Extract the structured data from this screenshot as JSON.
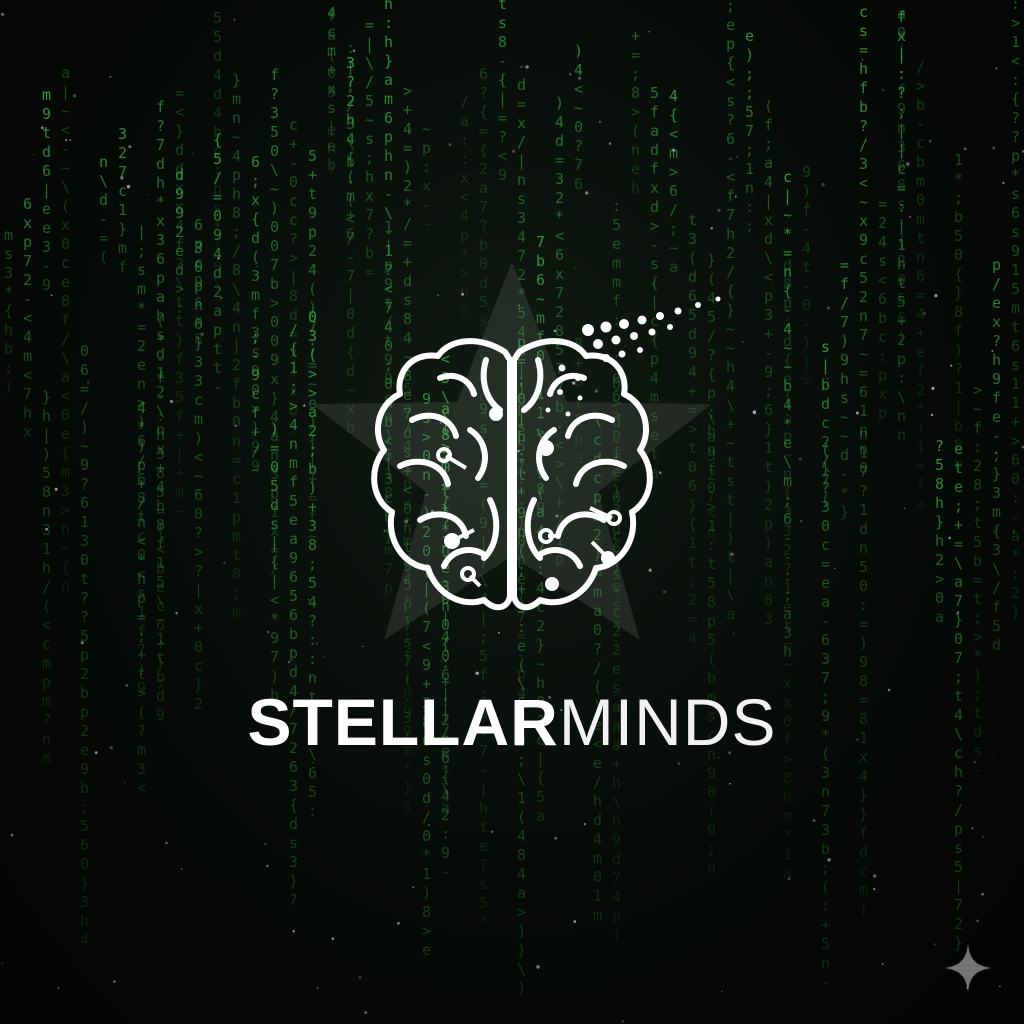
{
  "brand": {
    "name_bold": "STELLAR",
    "name_light": "MINDS"
  },
  "colors": {
    "background": "#050805",
    "matrix_green": "#3fbf4a",
    "logo_white": "#ffffff",
    "star": "#8a8f8a"
  },
  "icons": {
    "emblem": "brain-circuit-icon",
    "backdrop": "star-icon",
    "corner": "sparkle-icon"
  }
}
